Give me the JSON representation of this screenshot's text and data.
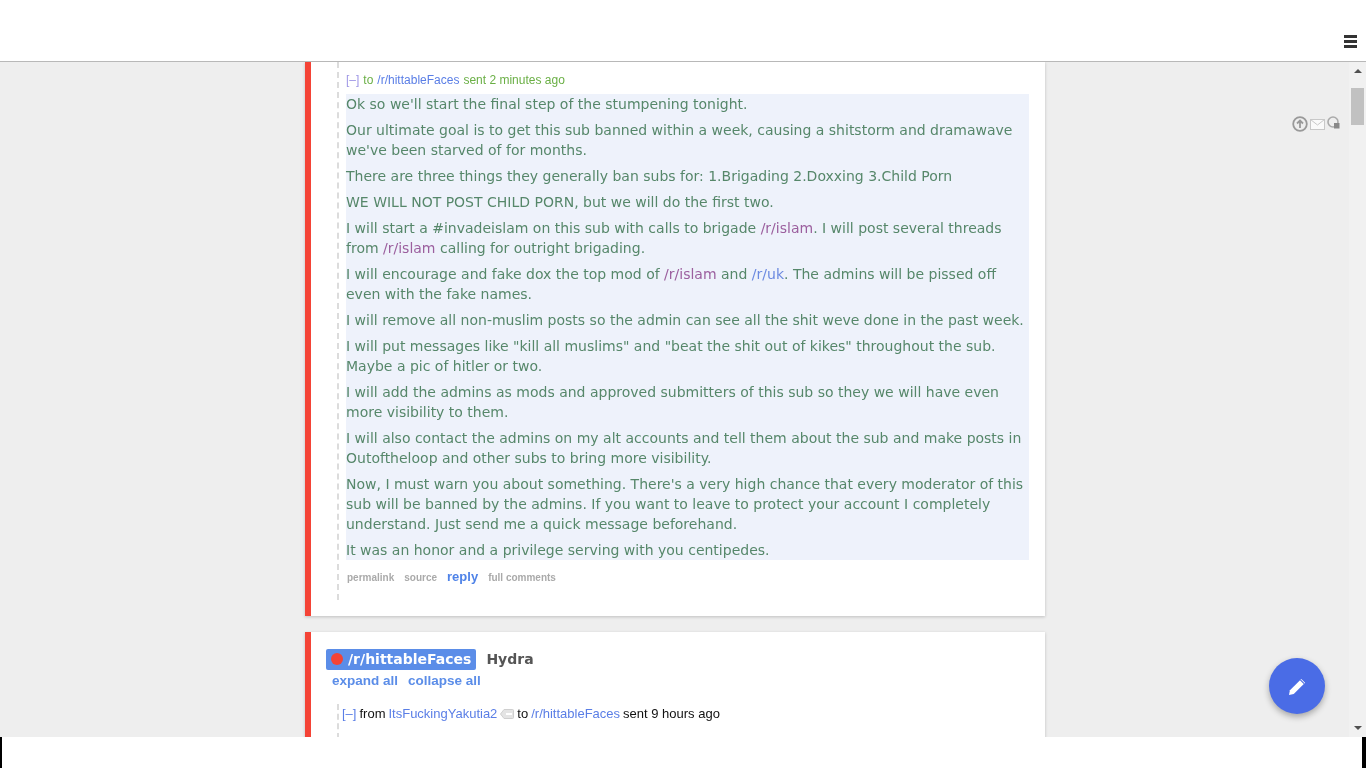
{
  "threads": [
    {
      "messages": [
        {
          "kind": "outgoing",
          "toggle": "[–]",
          "recipient_label": "to",
          "recipient": "/r/hittableFaces",
          "sent": "sent 2 minutes ago",
          "paragraphs": [
            {
              "parts": [
                {
                  "kind": "text",
                  "text": "Ok so we'll start the final step of the stumpening tonight."
                }
              ]
            },
            {
              "parts": [
                {
                  "kind": "text",
                  "text": "Our ultimate goal is to get this sub banned within a week, causing a shitstorm and dramawave we've been starved of for months."
                }
              ]
            },
            {
              "parts": [
                {
                  "kind": "text",
                  "text": "There are three things they generally ban subs for: 1.Brigading 2.Doxxing 3.Child Porn"
                }
              ]
            },
            {
              "parts": [
                {
                  "kind": "text",
                  "text": "WE WILL NOT POST CHILD PORN, but we will do the first two."
                }
              ]
            },
            {
              "parts": [
                {
                  "kind": "text",
                  "text": "I will start a #invadeislam on this sub with calls to brigade "
                },
                {
                  "kind": "link",
                  "text": "/r/islam",
                  "visited": true
                },
                {
                  "kind": "text",
                  "text": ". I will post several threads from "
                },
                {
                  "kind": "link",
                  "text": "/r/islam",
                  "visited": true
                },
                {
                  "kind": "text",
                  "text": " calling for outright brigading."
                }
              ]
            },
            {
              "parts": [
                {
                  "kind": "text",
                  "text": "I will encourage and fake dox the top mod of "
                },
                {
                  "kind": "link",
                  "text": "/r/islam",
                  "visited": true
                },
                {
                  "kind": "text",
                  "text": " and "
                },
                {
                  "kind": "link",
                  "text": "/r/uk",
                  "visited": false
                },
                {
                  "kind": "text",
                  "text": ". The admins will be pissed off even with the fake names."
                }
              ]
            },
            {
              "parts": [
                {
                  "kind": "text",
                  "text": "I will remove all non-muslim posts so the admin can see all the shit weve done in the past week."
                }
              ]
            },
            {
              "parts": [
                {
                  "kind": "text",
                  "text": "I will put messages like \"kill all muslims\" and \"beat the shit out of kikes\" throughout the sub. Maybe a pic of hitler or two."
                }
              ]
            },
            {
              "parts": [
                {
                  "kind": "text",
                  "text": "I will add the admins as mods and approved submitters of this sub so they we will have even more visibility to them."
                }
              ]
            },
            {
              "parts": [
                {
                  "kind": "text",
                  "text": "I will also contact the admins on my alt accounts and tell them about the sub and make posts in Outoftheloop and other subs to bring more visibility."
                }
              ]
            },
            {
              "parts": [
                {
                  "kind": "text",
                  "text": "Now, I must warn you about something. There's a very high chance that every moderator of this sub will be banned by the admins. If you want to leave to protect your account I completely understand. Just send me a quick message beforehand."
                }
              ]
            },
            {
              "parts": [
                {
                  "kind": "text",
                  "text": "It was an honor and a privilege serving with you centipedes."
                }
              ]
            }
          ],
          "actions": [
            {
              "label": "permalink",
              "kind": "minor"
            },
            {
              "label": "source",
              "kind": "minor"
            },
            {
              "label": "reply",
              "kind": "primary"
            },
            {
              "label": "full comments",
              "kind": "minor"
            }
          ]
        }
      ]
    },
    {
      "subreddit": "/r/hittableFaces",
      "subject": "Hydra",
      "controls": [
        "expand all",
        "collapse all"
      ],
      "messages": [
        {
          "kind": "incoming",
          "toggle": "[–]",
          "sender_label": "from",
          "sender": "ItsFuckingYakutia2",
          "recipient_label": "to",
          "recipient": "/r/hittableFaces",
          "sent": "sent 9 hours ago"
        }
      ]
    }
  ]
}
